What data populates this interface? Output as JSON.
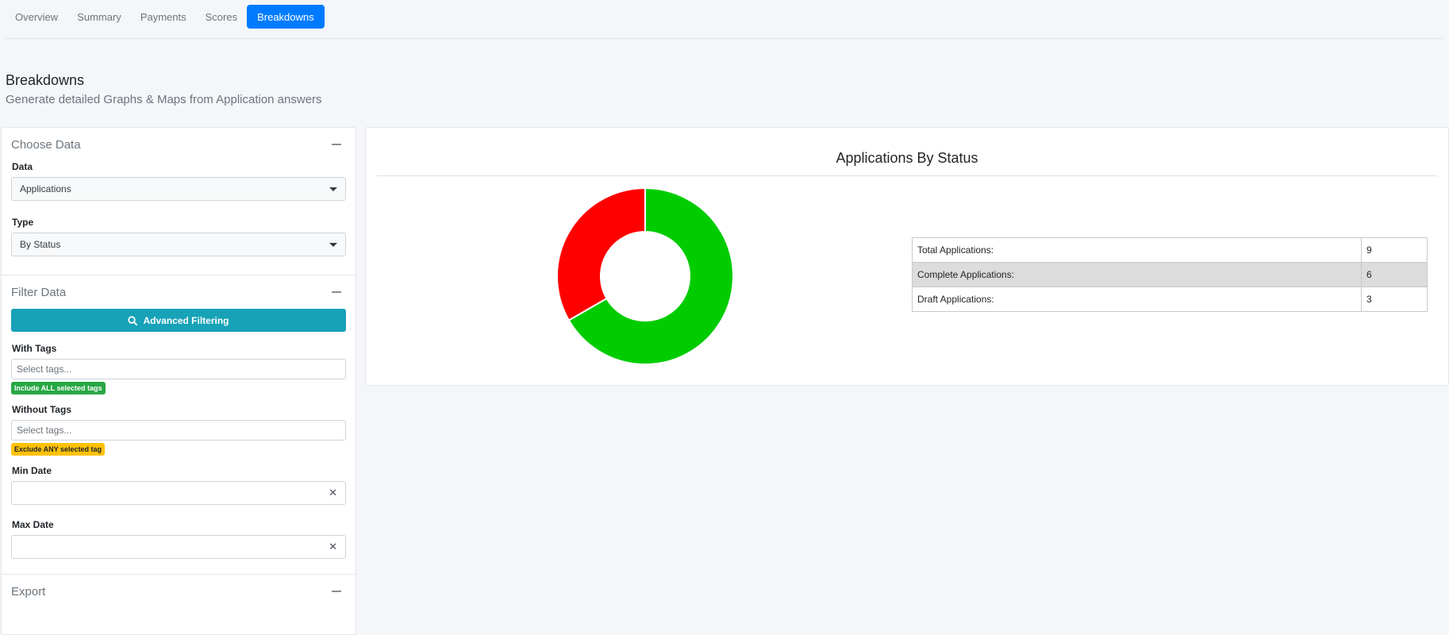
{
  "tabs": [
    {
      "label": "Overview"
    },
    {
      "label": "Summary"
    },
    {
      "label": "Payments"
    },
    {
      "label": "Scores"
    },
    {
      "label": "Breakdowns"
    }
  ],
  "page": {
    "title": "Breakdowns",
    "subtitle": "Generate detailed Graphs & Maps from Application answers"
  },
  "choose_data": {
    "title": "Choose Data",
    "data_label": "Data",
    "data_value": "Applications",
    "type_label": "Type",
    "type_value": "By Status"
  },
  "filter_data": {
    "title": "Filter Data",
    "advanced_button": "Advanced Filtering",
    "with_tags_label": "With Tags",
    "with_tags_placeholder": "Select tags...",
    "with_tags_badge": "Include ALL selected tags",
    "without_tags_label": "Without Tags",
    "without_tags_placeholder": "Select tags...",
    "without_tags_badge": "Exclude ANY selected tag",
    "min_date_label": "Min Date",
    "max_date_label": "Max Date",
    "clear_glyph": "✕"
  },
  "export": {
    "title": "Export"
  },
  "chart_data": {
    "type": "pie",
    "title": "Applications By Status",
    "labels": [
      "Complete",
      "Draft"
    ],
    "values": [
      6,
      3
    ],
    "colors": [
      "#00cc00",
      "#ff0000"
    ],
    "donut": true
  },
  "stats": [
    {
      "label": "Total Applications:",
      "value": "9"
    },
    {
      "label": "Complete Applications:",
      "value": "6"
    },
    {
      "label": "Draft Applications:",
      "value": "3"
    }
  ]
}
